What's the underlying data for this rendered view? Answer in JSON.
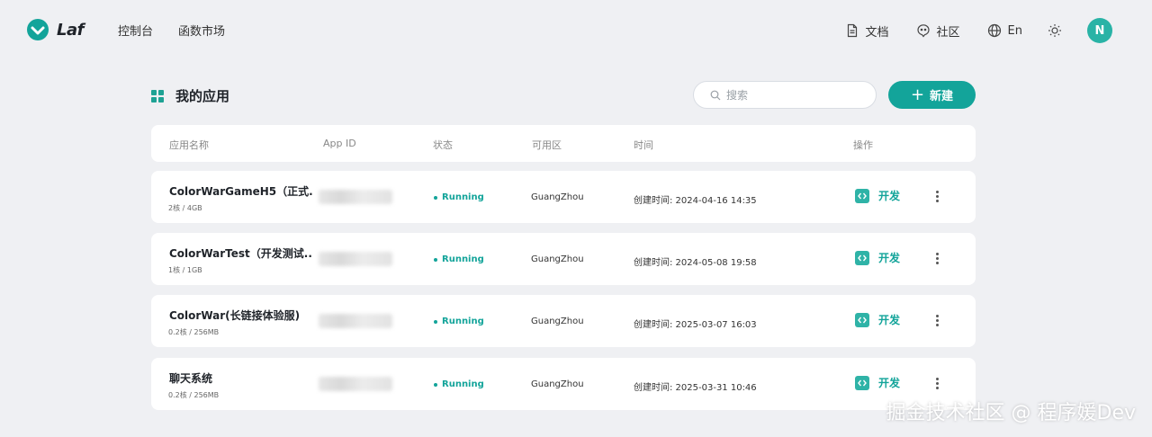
{
  "brand": {
    "name": "Laf",
    "accent": "#13a49a"
  },
  "nav": {
    "items": [
      "控制台",
      "函数市场"
    ]
  },
  "right_nav": {
    "docs": "文档",
    "community": "社区",
    "language": "En",
    "avatar_initial": "N"
  },
  "page": {
    "title": "我的应用"
  },
  "search": {
    "placeholder": "搜索"
  },
  "new_button": {
    "label": "新建"
  },
  "table": {
    "headers": [
      "应用名称",
      "App ID",
      "状态",
      "可用区",
      "时间",
      "操作"
    ],
    "rows": [
      {
        "name": "ColorWarGameH5（正式...",
        "spec": "2核 / 4GB",
        "status": "Running",
        "region": "GuangZhou",
        "time": "创建时间: 2024-04-16 14:35",
        "action": "开发"
      },
      {
        "name": "ColorWarTest（开发测试...",
        "spec": "1核 / 1GB",
        "status": "Running",
        "region": "GuangZhou",
        "time": "创建时间: 2024-05-08 19:58",
        "action": "开发"
      },
      {
        "name": "ColorWar(长链接体验服)",
        "spec": "0.2核 / 256MB",
        "status": "Running",
        "region": "GuangZhou",
        "time": "创建时间: 2025-03-07 16:03",
        "action": "开发"
      },
      {
        "name": "聊天系统",
        "spec": "0.2核 / 256MB",
        "status": "Running",
        "region": "GuangZhou",
        "time": "创建时间: 2025-03-31 10:46",
        "action": "开发"
      }
    ]
  },
  "watermark": "掘金技术社区 @ 程序媛Dev"
}
